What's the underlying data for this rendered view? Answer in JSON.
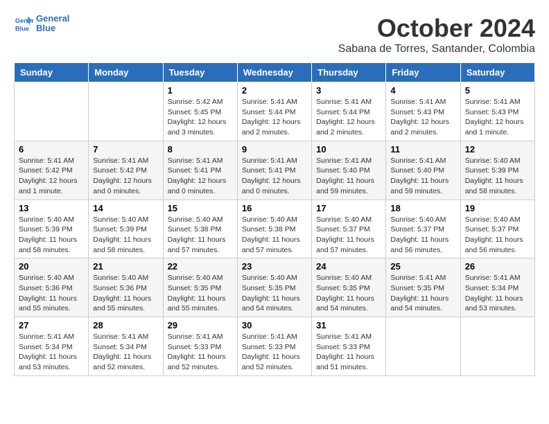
{
  "header": {
    "logo_line1": "General",
    "logo_line2": "Blue",
    "month": "October 2024",
    "location": "Sabana de Torres, Santander, Colombia"
  },
  "days_of_week": [
    "Sunday",
    "Monday",
    "Tuesday",
    "Wednesday",
    "Thursday",
    "Friday",
    "Saturday"
  ],
  "weeks": [
    [
      {
        "day": "",
        "info": ""
      },
      {
        "day": "",
        "info": ""
      },
      {
        "day": "1",
        "info": "Sunrise: 5:42 AM\nSunset: 5:45 PM\nDaylight: 12 hours and 3 minutes."
      },
      {
        "day": "2",
        "info": "Sunrise: 5:41 AM\nSunset: 5:44 PM\nDaylight: 12 hours and 2 minutes."
      },
      {
        "day": "3",
        "info": "Sunrise: 5:41 AM\nSunset: 5:44 PM\nDaylight: 12 hours and 2 minutes."
      },
      {
        "day": "4",
        "info": "Sunrise: 5:41 AM\nSunset: 5:43 PM\nDaylight: 12 hours and 2 minutes."
      },
      {
        "day": "5",
        "info": "Sunrise: 5:41 AM\nSunset: 5:43 PM\nDaylight: 12 hours and 1 minute."
      }
    ],
    [
      {
        "day": "6",
        "info": "Sunrise: 5:41 AM\nSunset: 5:42 PM\nDaylight: 12 hours and 1 minute."
      },
      {
        "day": "7",
        "info": "Sunrise: 5:41 AM\nSunset: 5:42 PM\nDaylight: 12 hours and 0 minutes."
      },
      {
        "day": "8",
        "info": "Sunrise: 5:41 AM\nSunset: 5:41 PM\nDaylight: 12 hours and 0 minutes."
      },
      {
        "day": "9",
        "info": "Sunrise: 5:41 AM\nSunset: 5:41 PM\nDaylight: 12 hours and 0 minutes."
      },
      {
        "day": "10",
        "info": "Sunrise: 5:41 AM\nSunset: 5:40 PM\nDaylight: 11 hours and 59 minutes."
      },
      {
        "day": "11",
        "info": "Sunrise: 5:41 AM\nSunset: 5:40 PM\nDaylight: 11 hours and 59 minutes."
      },
      {
        "day": "12",
        "info": "Sunrise: 5:40 AM\nSunset: 5:39 PM\nDaylight: 11 hours and 58 minutes."
      }
    ],
    [
      {
        "day": "13",
        "info": "Sunrise: 5:40 AM\nSunset: 5:39 PM\nDaylight: 11 hours and 58 minutes."
      },
      {
        "day": "14",
        "info": "Sunrise: 5:40 AM\nSunset: 5:39 PM\nDaylight: 11 hours and 58 minutes."
      },
      {
        "day": "15",
        "info": "Sunrise: 5:40 AM\nSunset: 5:38 PM\nDaylight: 11 hours and 57 minutes."
      },
      {
        "day": "16",
        "info": "Sunrise: 5:40 AM\nSunset: 5:38 PM\nDaylight: 11 hours and 57 minutes."
      },
      {
        "day": "17",
        "info": "Sunrise: 5:40 AM\nSunset: 5:37 PM\nDaylight: 11 hours and 57 minutes."
      },
      {
        "day": "18",
        "info": "Sunrise: 5:40 AM\nSunset: 5:37 PM\nDaylight: 11 hours and 56 minutes."
      },
      {
        "day": "19",
        "info": "Sunrise: 5:40 AM\nSunset: 5:37 PM\nDaylight: 11 hours and 56 minutes."
      }
    ],
    [
      {
        "day": "20",
        "info": "Sunrise: 5:40 AM\nSunset: 5:36 PM\nDaylight: 11 hours and 55 minutes."
      },
      {
        "day": "21",
        "info": "Sunrise: 5:40 AM\nSunset: 5:36 PM\nDaylight: 11 hours and 55 minutes."
      },
      {
        "day": "22",
        "info": "Sunrise: 5:40 AM\nSunset: 5:35 PM\nDaylight: 11 hours and 55 minutes."
      },
      {
        "day": "23",
        "info": "Sunrise: 5:40 AM\nSunset: 5:35 PM\nDaylight: 11 hours and 54 minutes."
      },
      {
        "day": "24",
        "info": "Sunrise: 5:40 AM\nSunset: 5:35 PM\nDaylight: 11 hours and 54 minutes."
      },
      {
        "day": "25",
        "info": "Sunrise: 5:41 AM\nSunset: 5:35 PM\nDaylight: 11 hours and 54 minutes."
      },
      {
        "day": "26",
        "info": "Sunrise: 5:41 AM\nSunset: 5:34 PM\nDaylight: 11 hours and 53 minutes."
      }
    ],
    [
      {
        "day": "27",
        "info": "Sunrise: 5:41 AM\nSunset: 5:34 PM\nDaylight: 11 hours and 53 minutes."
      },
      {
        "day": "28",
        "info": "Sunrise: 5:41 AM\nSunset: 5:34 PM\nDaylight: 11 hours and 52 minutes."
      },
      {
        "day": "29",
        "info": "Sunrise: 5:41 AM\nSunset: 5:33 PM\nDaylight: 11 hours and 52 minutes."
      },
      {
        "day": "30",
        "info": "Sunrise: 5:41 AM\nSunset: 5:33 PM\nDaylight: 11 hours and 52 minutes."
      },
      {
        "day": "31",
        "info": "Sunrise: 5:41 AM\nSunset: 5:33 PM\nDaylight: 11 hours and 51 minutes."
      },
      {
        "day": "",
        "info": ""
      },
      {
        "day": "",
        "info": ""
      }
    ]
  ]
}
